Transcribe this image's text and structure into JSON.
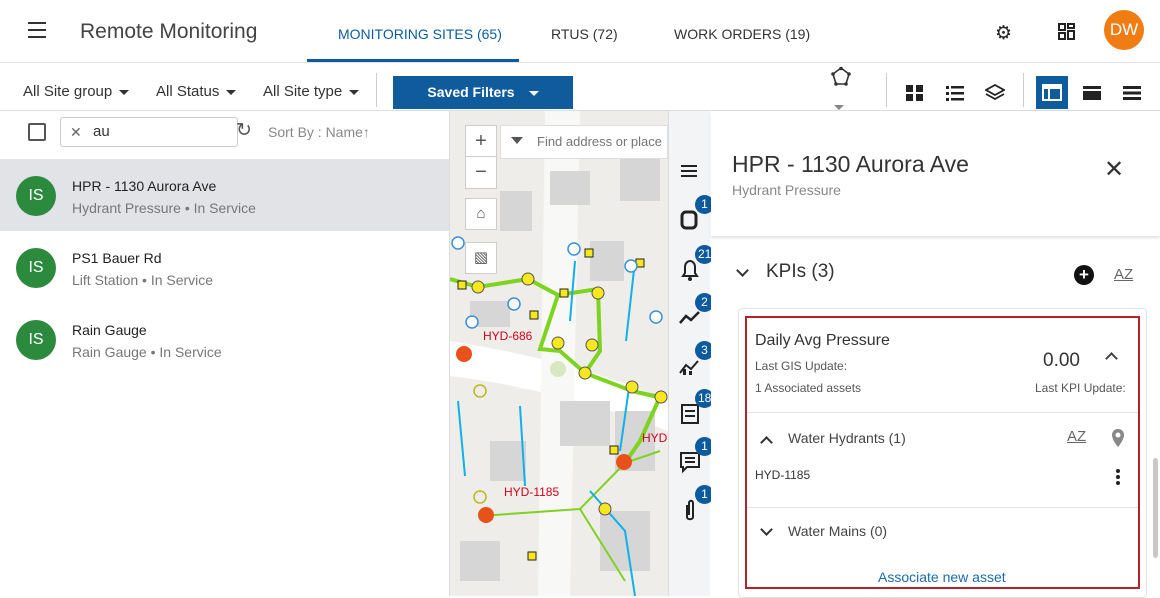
{
  "app": {
    "title": "Remote Monitoring",
    "tabs": [
      {
        "label": "MONITORING SITES (65)"
      },
      {
        "label": "RTUS (72)"
      },
      {
        "label": "WORK ORDERS (19)"
      }
    ],
    "user_initials": "DW",
    "accent": "#0d5b9e",
    "avatar_color": "#f07d13"
  },
  "filters": {
    "site_group": "All Site group",
    "status": "All Status",
    "site_type": "All Site type",
    "saved_filters": "Saved Filters"
  },
  "list": {
    "search_value": "au",
    "sort_label": "Sort By : Name",
    "items": [
      {
        "initials": "IS",
        "name": "HPR - 1130 Aurora Ave",
        "sub": "Hydrant Pressure • In Service"
      },
      {
        "initials": "IS",
        "name": "PS1 Bauer Rd",
        "sub": "Lift Station • In Service"
      },
      {
        "initials": "IS",
        "name": "Rain Gauge",
        "sub": "Rain Gauge • In Service"
      }
    ]
  },
  "map": {
    "search_placeholder": "Find address or place",
    "labels": [
      "HYD-686",
      "HYD-1185",
      "HYD"
    ]
  },
  "rail": {
    "badges": [
      "1",
      "21",
      "2",
      "3",
      "18",
      "1",
      "1"
    ]
  },
  "detail": {
    "title": "HPR - 1130 Aurora Ave",
    "subtitle": "Hydrant Pressure",
    "kpi_header": "KPIs (3)",
    "kpi": {
      "name": "Daily Avg Pressure",
      "gis_update": "Last GIS Update:",
      "assets": "1 Associated assets",
      "value": "0.00",
      "kpi_update": "Last KPI Update:",
      "section_hydrants": "Water Hydrants (1)",
      "asset_id": "HYD-1185",
      "section_mains": "Water Mains (0)",
      "associate": "Associate new asset"
    }
  }
}
